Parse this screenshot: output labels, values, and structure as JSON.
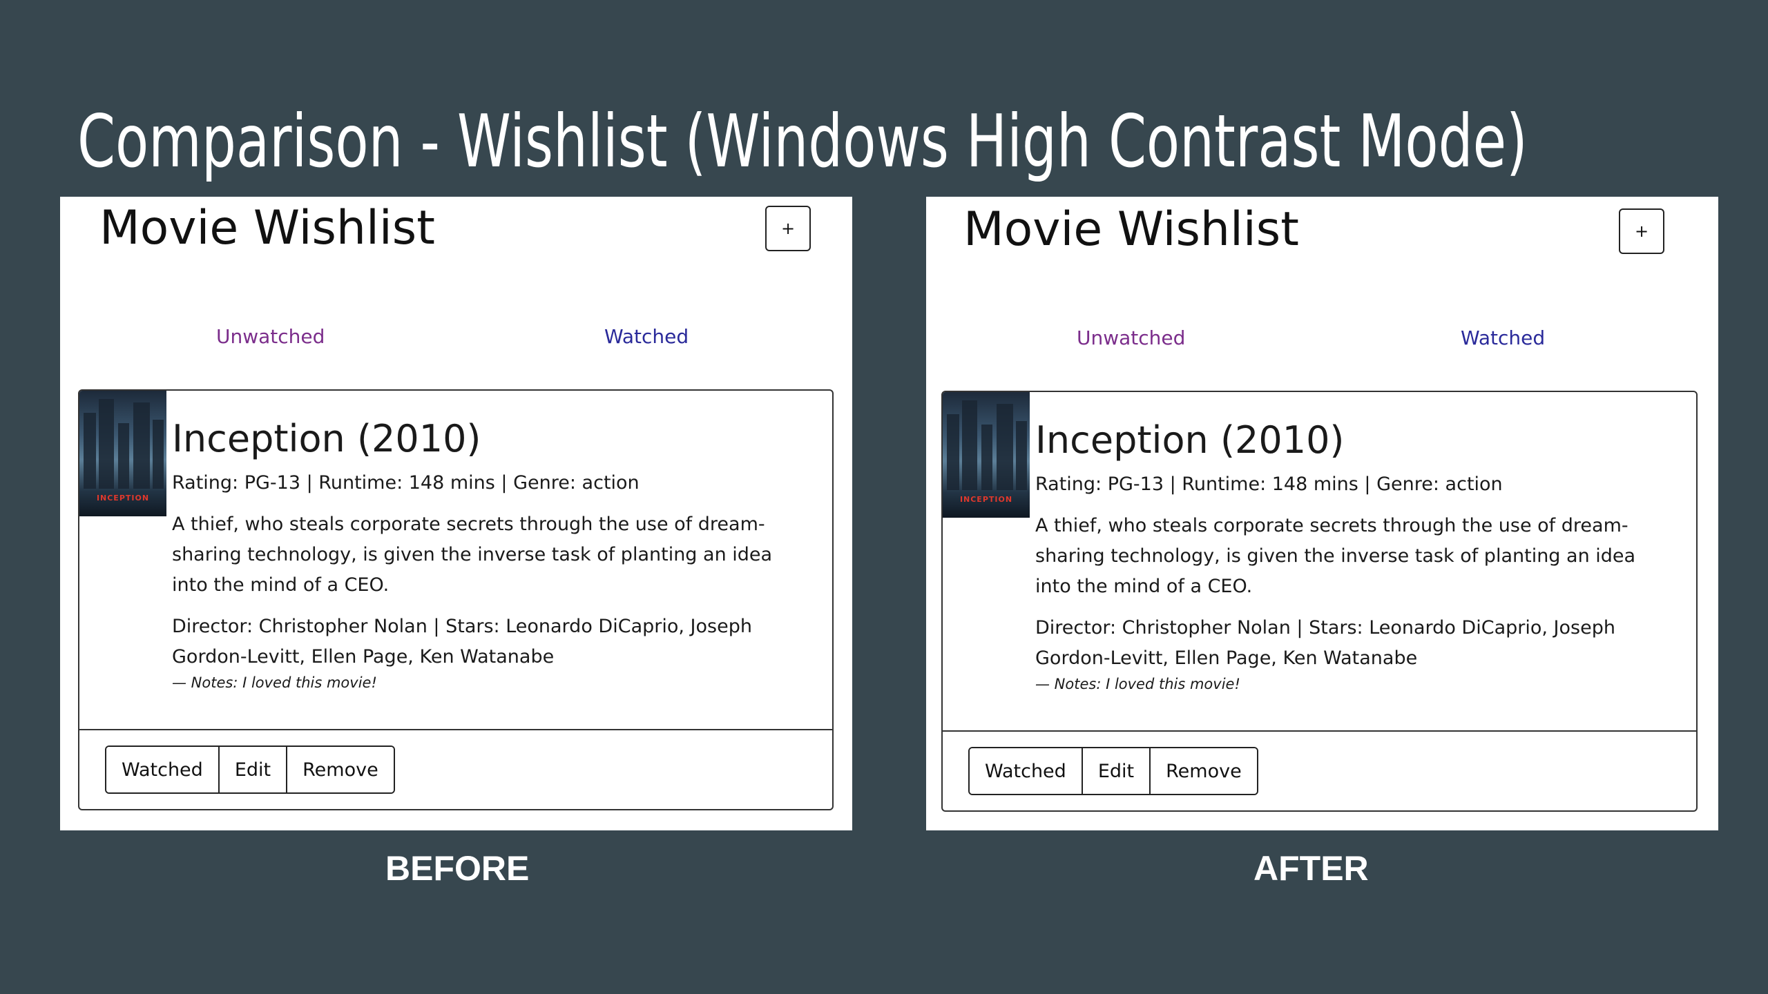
{
  "slide": {
    "title": "Comparison - Wishlist (Windows High Contrast Mode)",
    "captions": {
      "before": "BEFORE",
      "after": "AFTER"
    }
  },
  "app": {
    "heading": "Movie Wishlist",
    "add_button_label": "+",
    "tabs": {
      "unwatched": "Unwatched",
      "watched": "Watched"
    },
    "movie": {
      "title": "Inception (2010)",
      "meta": "Rating: PG-13 | Runtime: 148 mins | Genre: action",
      "description": "A thief, who steals corporate secrets through the use of dream-sharing technology, is given the inverse task of planting an idea into the mind of a CEO.",
      "credits": "Director: Christopher Nolan | Stars: Leonardo DiCaprio, Joseph Gordon-Levitt, Ellen Page, Ken Watanabe",
      "notes": "— Notes: I loved this movie!",
      "poster_text": "INCEPTION"
    },
    "actions": {
      "watched": "Watched",
      "edit": "Edit",
      "remove": "Remove"
    }
  },
  "colors": {
    "slide_background": "#37474f",
    "tab_unwatched": "#7b2d8b",
    "tab_watched": "#2a2a9a"
  }
}
